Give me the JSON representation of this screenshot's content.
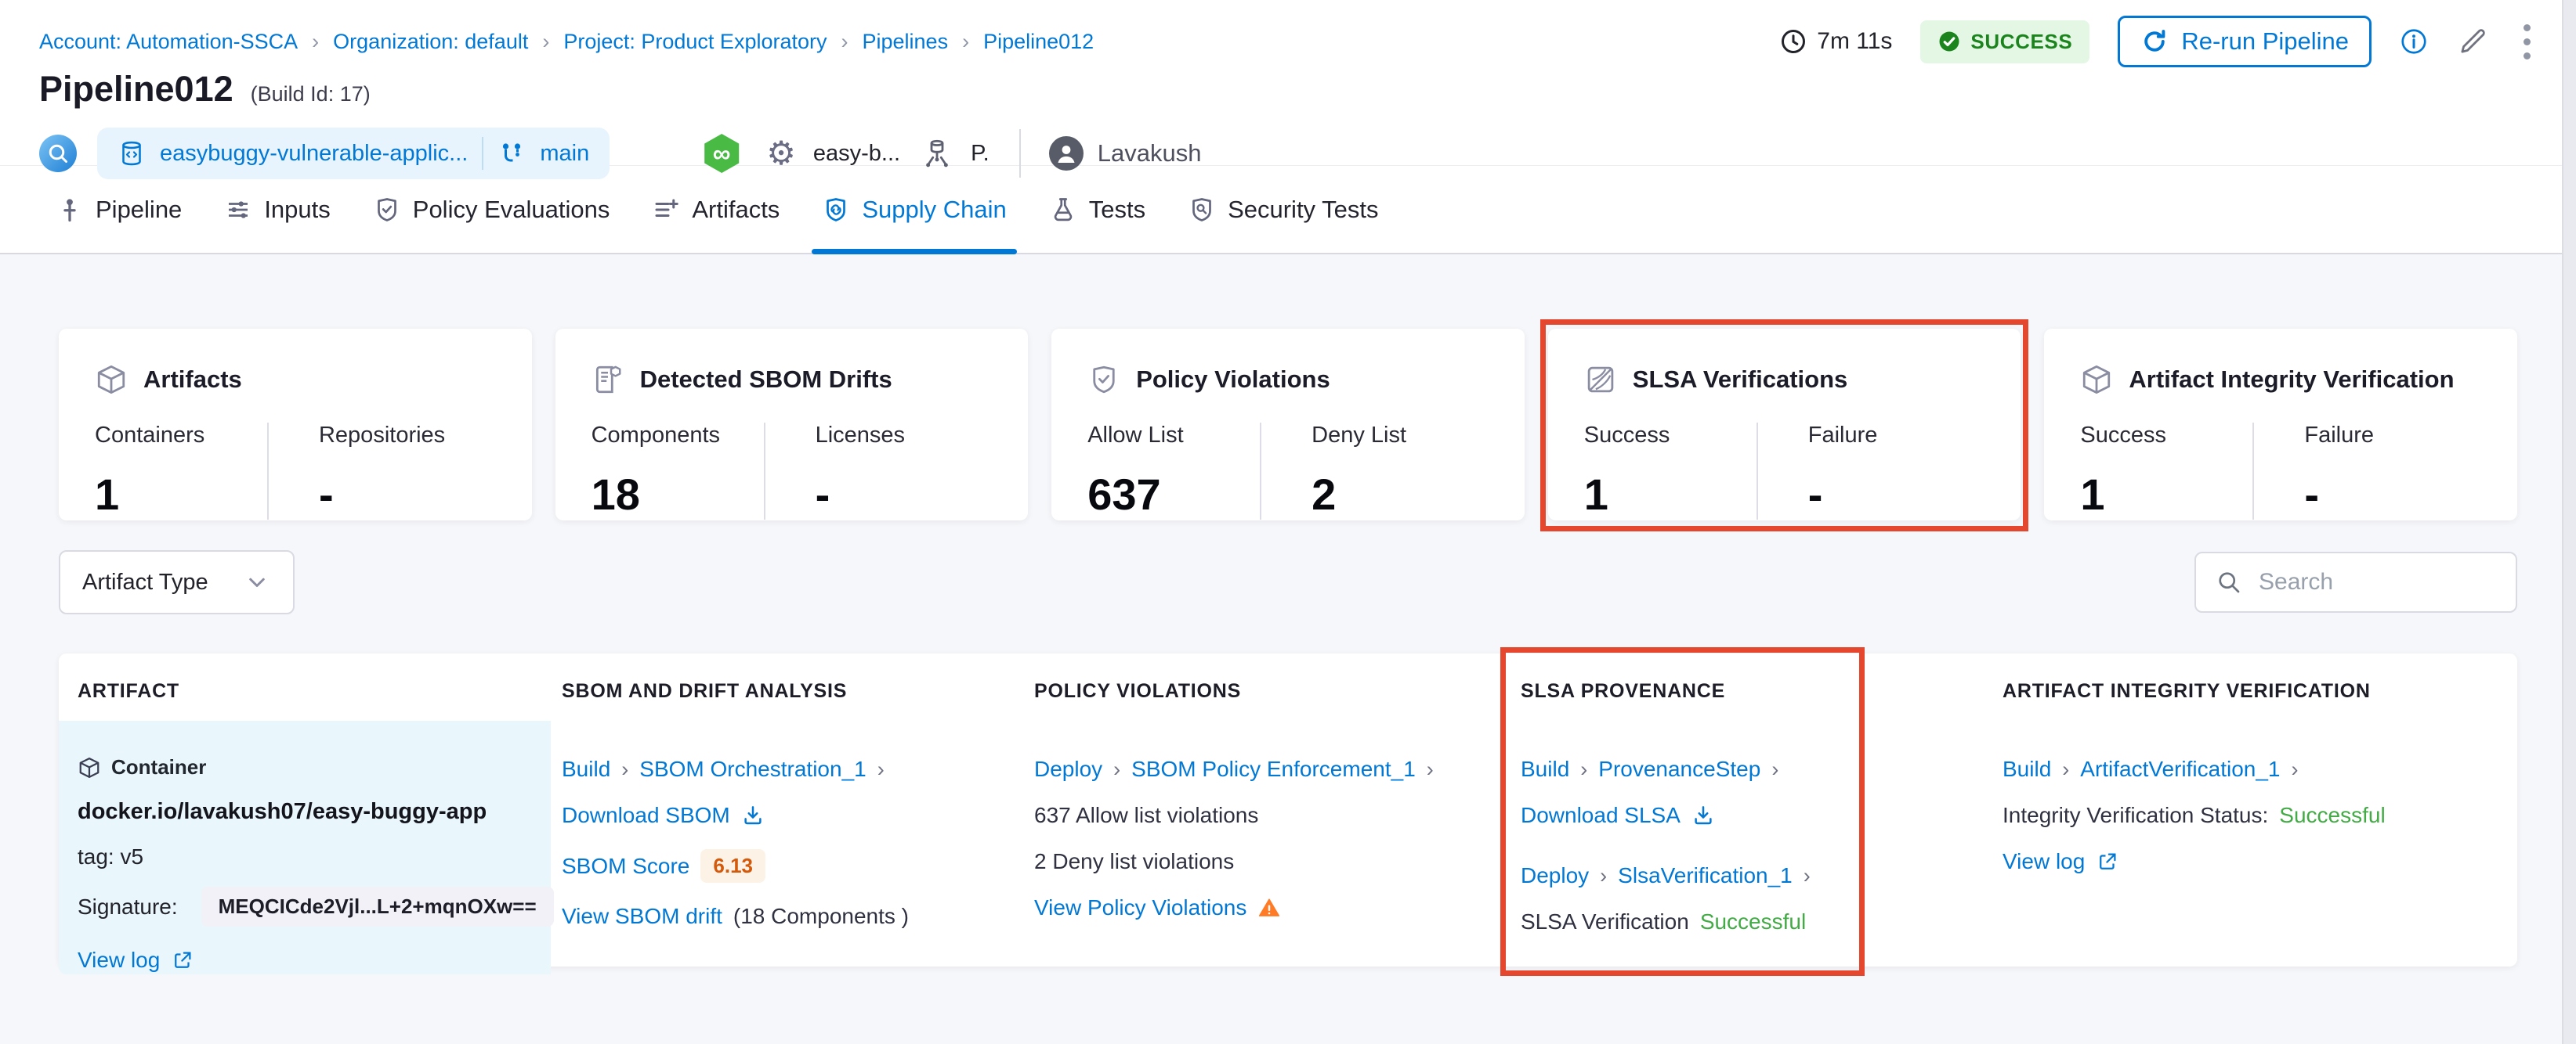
{
  "colors": {
    "accent": "#0278d5",
    "success_text": "#42ab45",
    "badge_green": "#1b841d",
    "highlight_red": "#e5462e",
    "warning_orange": "#ff7b26"
  },
  "breadcrumb": {
    "items": [
      {
        "label": "Account: Automation-SSCA"
      },
      {
        "label": "Organization: default"
      },
      {
        "label": "Project: Product Exploratory"
      },
      {
        "label": "Pipelines"
      },
      {
        "label": "Pipeline012"
      }
    ]
  },
  "header": {
    "duration": "7m 11s",
    "status": "SUCCESS",
    "rerun_label": "Re-run Pipeline",
    "title": "Pipeline012",
    "build_id": "(Build Id: 17)",
    "repo": "easybuggy-vulnerable-applic...",
    "branch": "main",
    "trigger": "easy-b...",
    "trigger_secondary": "P.",
    "user": "Lavakush",
    "infinity_glyph": "∞",
    "gear_glyph": "⚙"
  },
  "tabs": [
    {
      "label": "Pipeline"
    },
    {
      "label": "Inputs"
    },
    {
      "label": "Policy Evaluations"
    },
    {
      "label": "Artifacts"
    },
    {
      "label": "Supply Chain"
    },
    {
      "label": "Tests"
    },
    {
      "label": "Security Tests"
    }
  ],
  "summary_cards": [
    {
      "title": "Artifacts",
      "stats": [
        {
          "label": "Containers",
          "value": "1"
        },
        {
          "label": "Repositories",
          "value": "-"
        }
      ]
    },
    {
      "title": "Detected SBOM Drifts",
      "stats": [
        {
          "label": "Components",
          "value": "18"
        },
        {
          "label": "Licenses",
          "value": "-"
        }
      ]
    },
    {
      "title": "Policy Violations",
      "stats": [
        {
          "label": "Allow List",
          "value": "637"
        },
        {
          "label": "Deny List",
          "value": "2"
        }
      ]
    },
    {
      "title": "SLSA Verifications",
      "stats": [
        {
          "label": "Success",
          "value": "1"
        },
        {
          "label": "Failure",
          "value": "-"
        }
      ]
    },
    {
      "title": "Artifact Integrity Verification",
      "stats": [
        {
          "label": "Success",
          "value": "1"
        },
        {
          "label": "Failure",
          "value": "-"
        }
      ]
    }
  ],
  "filters": {
    "artifact_type": "Artifact Type",
    "search_placeholder": "Search"
  },
  "table": {
    "headers": [
      "ARTIFACT",
      "SBOM AND DRIFT ANALYSIS",
      "POLICY VIOLATIONS",
      "SLSA PROVENANCE",
      "ARTIFACT INTEGRITY VERIFICATION"
    ],
    "row": {
      "artifact": {
        "type_label": "Container",
        "image": "docker.io/lavakush07/easy-buggy-app",
        "tag": "tag: v5",
        "signature_label": "Signature:",
        "signature_value": "MEQCICde2Vjl...L+2+mqnOXw==",
        "view_log": "View log"
      },
      "sbom": {
        "stage": "Build",
        "step": "SBOM Orchestration_1",
        "download": "Download SBOM",
        "score_label": "SBOM Score",
        "score": "6.13",
        "drift_link": "View SBOM drift",
        "drift_count": "(18 Components )"
      },
      "policy": {
        "stage": "Deploy",
        "step": "SBOM Policy Enforcement_1",
        "allow": "637 Allow list violations",
        "deny": "2 Deny list violations",
        "view": "View Policy Violations"
      },
      "slsa": {
        "stage1": "Build",
        "step1": "ProvenanceStep",
        "download": "Download SLSA",
        "stage2": "Deploy",
        "step2": "SlsaVerification_1",
        "status_label": "SLSA Verification",
        "status_value": "Successful"
      },
      "integrity": {
        "stage": "Build",
        "step": "ArtifactVerification_1",
        "status_label": "Integrity Verification Status:",
        "status_value": "Successful",
        "view_log": "View log"
      }
    }
  }
}
